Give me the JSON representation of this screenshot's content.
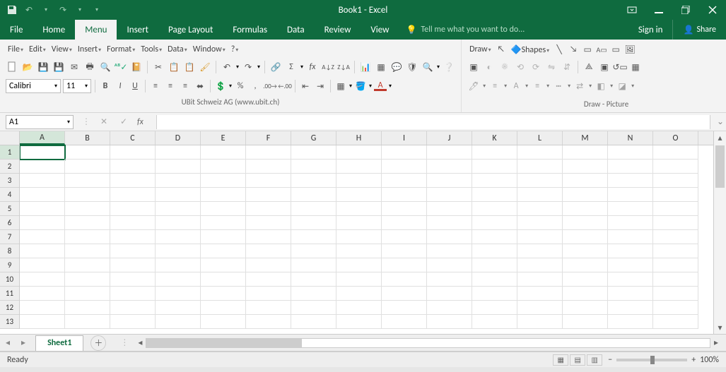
{
  "title": "Book1 - Excel",
  "qat": [
    "save",
    "undo",
    "redo",
    "customize"
  ],
  "ribbon": {
    "tabs": [
      "File",
      "Home",
      "Menu",
      "Insert",
      "Page Layout",
      "Formulas",
      "Data",
      "Review",
      "View"
    ],
    "active": "Menu",
    "tellme": "Tell me what you want to do...",
    "signin": "Sign in",
    "share": "Share"
  },
  "menubar": {
    "left": [
      "File",
      "Edit",
      "View",
      "Insert",
      "Format",
      "Tools",
      "Data",
      "Window",
      "?"
    ],
    "right": [
      "Draw",
      "",
      "Shapes"
    ]
  },
  "font": {
    "name": "Calibri",
    "size": "11"
  },
  "credits": {
    "left": "UBit Schweiz AG     (www.ubit.ch)",
    "right": "Draw - Picture"
  },
  "namebox": "A1",
  "columns": [
    "A",
    "B",
    "C",
    "D",
    "E",
    "F",
    "G",
    "H",
    "I",
    "J",
    "K",
    "L",
    "M",
    "N",
    "O"
  ],
  "rows": [
    "1",
    "2",
    "3",
    "4",
    "5",
    "6",
    "7",
    "8",
    "9",
    "10",
    "11",
    "12",
    "13"
  ],
  "selected": {
    "row": 0,
    "col": 0
  },
  "sheet_tab": "Sheet1",
  "status": "Ready",
  "zoom": "100%"
}
